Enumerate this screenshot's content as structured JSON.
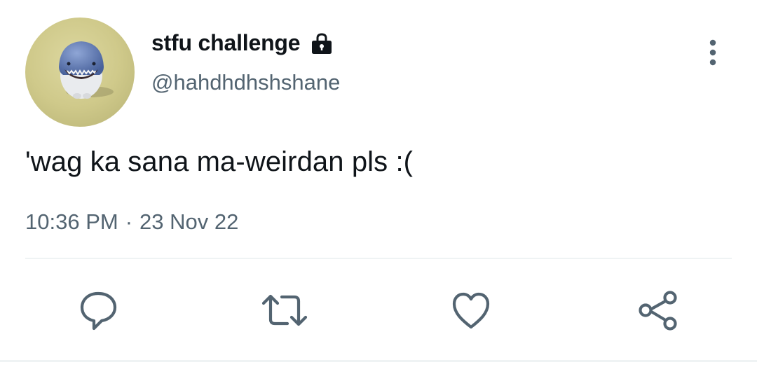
{
  "tweet": {
    "display_name": "stfu challenge",
    "handle": "@hahdhdhshshane",
    "text": "'wag ka sana ma-weirdan pls :(",
    "time": "10:36 PM",
    "separator": "·",
    "date": "23 Nov 22",
    "locked": true
  },
  "icons": {
    "lock": "lock-icon",
    "more": "more-vertical-icon",
    "reply": "reply-icon",
    "retweet": "retweet-icon",
    "like": "heart-icon",
    "share": "share-icon"
  },
  "colors": {
    "text_primary": "#0f1419",
    "text_secondary": "#536471",
    "icon": "#536471",
    "divider": "#eff3f4"
  }
}
